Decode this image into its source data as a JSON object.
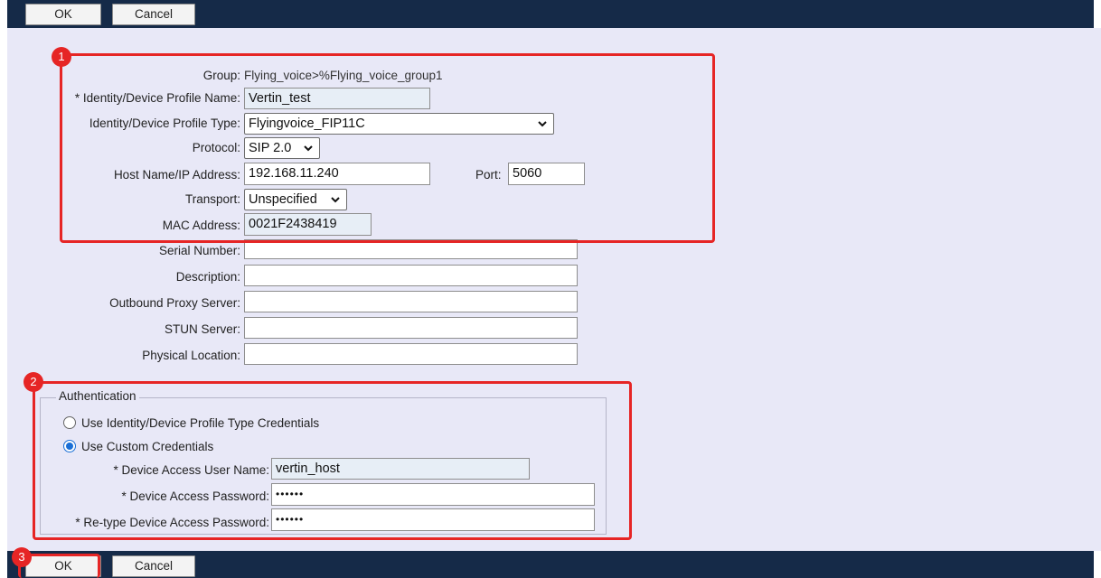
{
  "toolbar": {
    "ok_label": "OK",
    "cancel_label": "Cancel"
  },
  "form": {
    "group": {
      "label": "Group:",
      "value": "Flying_voice>%Flying_voice_group1"
    },
    "profile_name": {
      "label": "* Identity/Device Profile Name:",
      "value": "Vertin_test"
    },
    "profile_type": {
      "label": "Identity/Device Profile Type:",
      "value": "Flyingvoice_FIP11C"
    },
    "protocol": {
      "label": "Protocol:",
      "value": "SIP 2.0"
    },
    "host": {
      "label": "Host Name/IP Address:",
      "value": "192.168.11.240"
    },
    "port": {
      "label": "Port:",
      "value": "5060"
    },
    "transport": {
      "label": "Transport:",
      "value": "Unspecified"
    },
    "mac": {
      "label": "MAC Address:",
      "value": "0021F2438419"
    },
    "serial": {
      "label": "Serial Number:",
      "value": ""
    },
    "description": {
      "label": "Description:",
      "value": ""
    },
    "outbound_proxy": {
      "label": "Outbound Proxy Server:",
      "value": ""
    },
    "stun": {
      "label": "STUN Server:",
      "value": ""
    },
    "location": {
      "label": "Physical Location:",
      "value": ""
    }
  },
  "auth": {
    "legend": "Authentication",
    "option_type_credentials": "Use Identity/Device Profile Type Credentials",
    "option_custom_credentials": "Use Custom Credentials",
    "selected": "custom",
    "user": {
      "label": "* Device Access User Name:",
      "value": "vertin_host"
    },
    "password": {
      "label": "* Device Access Password:",
      "value": "••••••"
    },
    "retype": {
      "label": "* Re-type Device Access Password:",
      "value": "••••••"
    }
  },
  "markers": {
    "m1": "1",
    "m2": "2",
    "m3": "3"
  },
  "colors": {
    "header_bar": "#152a48",
    "form_bg": "#e8e8f7",
    "callout": "#e62525"
  },
  "icons": {
    "select_arrow": "chevron-down-icon"
  }
}
